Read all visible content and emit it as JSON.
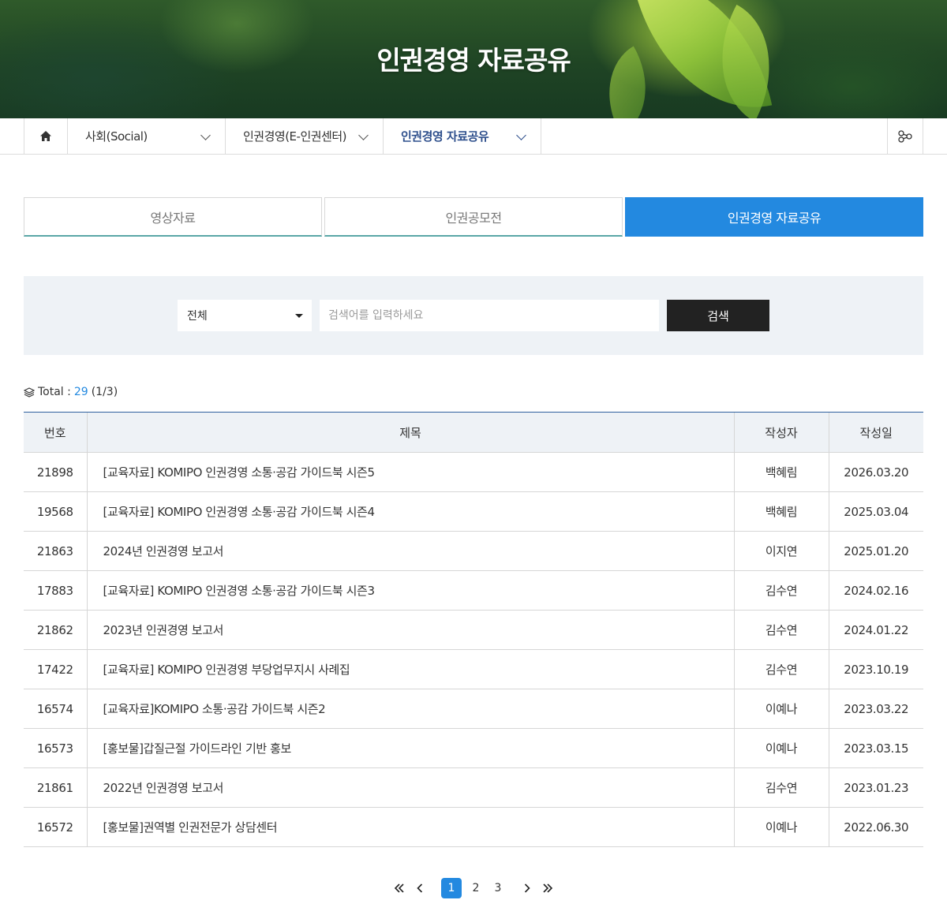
{
  "hero": {
    "title": "인권경영 자료공유"
  },
  "breadcrumb": {
    "home_icon": "home-icon",
    "items": [
      {
        "label": "사회(Social)"
      },
      {
        "label": "인권경영(E-인권센터)"
      },
      {
        "label": "인권경영 자료공유"
      }
    ],
    "share_icon": "share-icon"
  },
  "tabs": [
    {
      "label": "영상자료",
      "active": false
    },
    {
      "label": "인권공모전",
      "active": false
    },
    {
      "label": "인권경영 자료공유",
      "active": true
    }
  ],
  "search": {
    "category_selected": "전체",
    "placeholder": "검색어를 입력하세요",
    "button_label": "검색"
  },
  "summary": {
    "label": "Total :",
    "total": "29",
    "pages": "(1/3)"
  },
  "table": {
    "headers": [
      "번호",
      "제목",
      "작성자",
      "작성일"
    ],
    "rows": [
      {
        "no": "21898",
        "title": "[교육자료] KOMIPO 인권경영 소통·공감 가이드북 시즌5",
        "author": "백혜림",
        "date": "2026.03.20"
      },
      {
        "no": "19568",
        "title": "[교육자료] KOMIPO 인권경영 소통·공감 가이드북 시즌4",
        "author": "백혜림",
        "date": "2025.03.04"
      },
      {
        "no": "21863",
        "title": "2024년 인권경영 보고서",
        "author": "이지연",
        "date": "2025.01.20"
      },
      {
        "no": "17883",
        "title": "[교육자료] KOMIPO 인권경영 소통·공감 가이드북 시즌3",
        "author": "김수연",
        "date": "2024.02.16"
      },
      {
        "no": "21862",
        "title": "2023년 인권경영 보고서",
        "author": "김수연",
        "date": "2024.01.22"
      },
      {
        "no": "17422",
        "title": "[교육자료] KOMIPO 인권경영 부당업무지시 사례집",
        "author": "김수연",
        "date": "2023.10.19"
      },
      {
        "no": "16574",
        "title": "[교육자료]KOMIPO 소통·공감 가이드북 시즌2",
        "author": "이예나",
        "date": "2023.03.22"
      },
      {
        "no": "16573",
        "title": "[홍보물]갑질근절 가이드라인 기반 홍보",
        "author": "이예나",
        "date": "2023.03.15"
      },
      {
        "no": "21861",
        "title": "2022년 인권경영 보고서",
        "author": "김수연",
        "date": "2023.01.23"
      },
      {
        "no": "16572",
        "title": "[홍보물]권역별 인권전문가 상담센터",
        "author": "이예나",
        "date": "2022.06.30"
      }
    ]
  },
  "pagination": {
    "first": "«",
    "prev": "‹",
    "pages": [
      "1",
      "2",
      "3"
    ],
    "current": "1",
    "next": "›",
    "last": "»"
  },
  "colors": {
    "accent": "#2389e0",
    "breadcrumb_active": "#2e4f8c",
    "search_bg": "#eef2f6",
    "button_dark": "#222222"
  }
}
